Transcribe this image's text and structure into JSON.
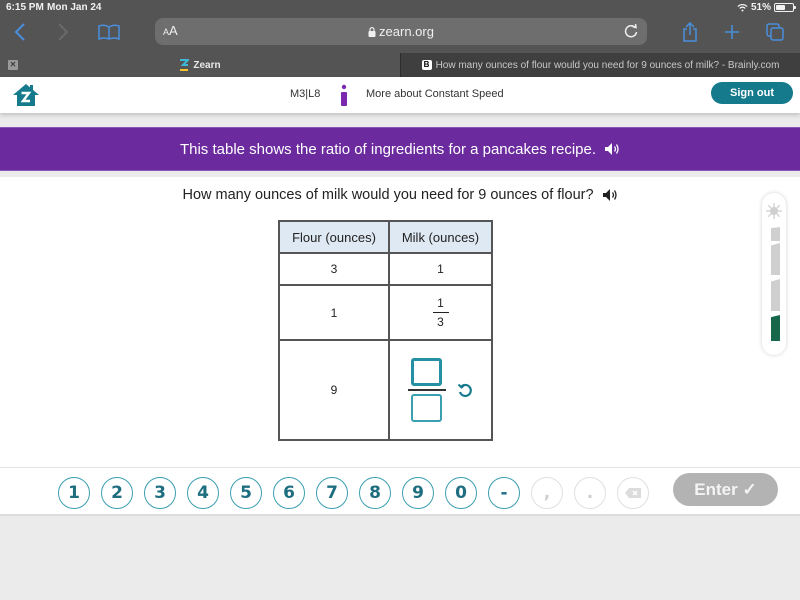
{
  "status_bar": {
    "time": "6:15 PM",
    "date": "Mon Jan 24",
    "battery_label": "51%",
    "battery_level": 0.51
  },
  "browser": {
    "text_size_label_small": "A",
    "text_size_label_large": "A",
    "url": "zearn.org",
    "icons": [
      "back-icon",
      "forward-icon",
      "bookmarks-icon",
      "lock-icon",
      "reload-icon",
      "share-icon",
      "new-tab-icon",
      "tabs-icon"
    ],
    "tabs": [
      {
        "label": "Zearn",
        "active": true
      },
      {
        "label": "How many ounces of flour would you need for 9 ounces of milk? - Brainly.com",
        "active": false
      }
    ]
  },
  "app_header": {
    "lesson_code": "M3|L8",
    "lesson_title": "More about Constant Speed",
    "sign_out_label": "Sign out"
  },
  "banner": {
    "text": "This table shows the ratio of ingredients for a pancakes recipe."
  },
  "question": {
    "text": "How many ounces of milk would you need for 9 ounces of flour?"
  },
  "ratio_table": {
    "headers": [
      "Flour (ounces)",
      "Milk (ounces)"
    ],
    "rows": [
      {
        "flour": "3",
        "milk": "1"
      },
      {
        "flour": "1",
        "milk_numerator": "1",
        "milk_denominator": "3"
      },
      {
        "flour": "9",
        "milk_numerator_input": "",
        "milk_denominator_input": ""
      }
    ]
  },
  "progress_meter": {
    "segments_total": 4,
    "segments_filled": 1,
    "colors": {
      "filled": "#17684b",
      "empty": "#cfcfcf"
    }
  },
  "keypad": {
    "keys": [
      {
        "label": "1",
        "enabled": true
      },
      {
        "label": "2",
        "enabled": true
      },
      {
        "label": "3",
        "enabled": true
      },
      {
        "label": "4",
        "enabled": true
      },
      {
        "label": "5",
        "enabled": true
      },
      {
        "label": "6",
        "enabled": true
      },
      {
        "label": "7",
        "enabled": true
      },
      {
        "label": "8",
        "enabled": true
      },
      {
        "label": "9",
        "enabled": true
      },
      {
        "label": "0",
        "enabled": true
      },
      {
        "label": "-",
        "enabled": true
      },
      {
        "label": ",",
        "enabled": false
      },
      {
        "label": ".",
        "enabled": false
      },
      {
        "label": "⌫",
        "enabled": false
      }
    ],
    "enter_label": "Enter ✓"
  },
  "colors": {
    "brand_teal": "#157a8c",
    "banner_purple": "#6b2a9e",
    "mission_purple": "#7b2ab0",
    "key_border": "#3a9fb0",
    "enter_disabled": "#b3b3b3"
  }
}
